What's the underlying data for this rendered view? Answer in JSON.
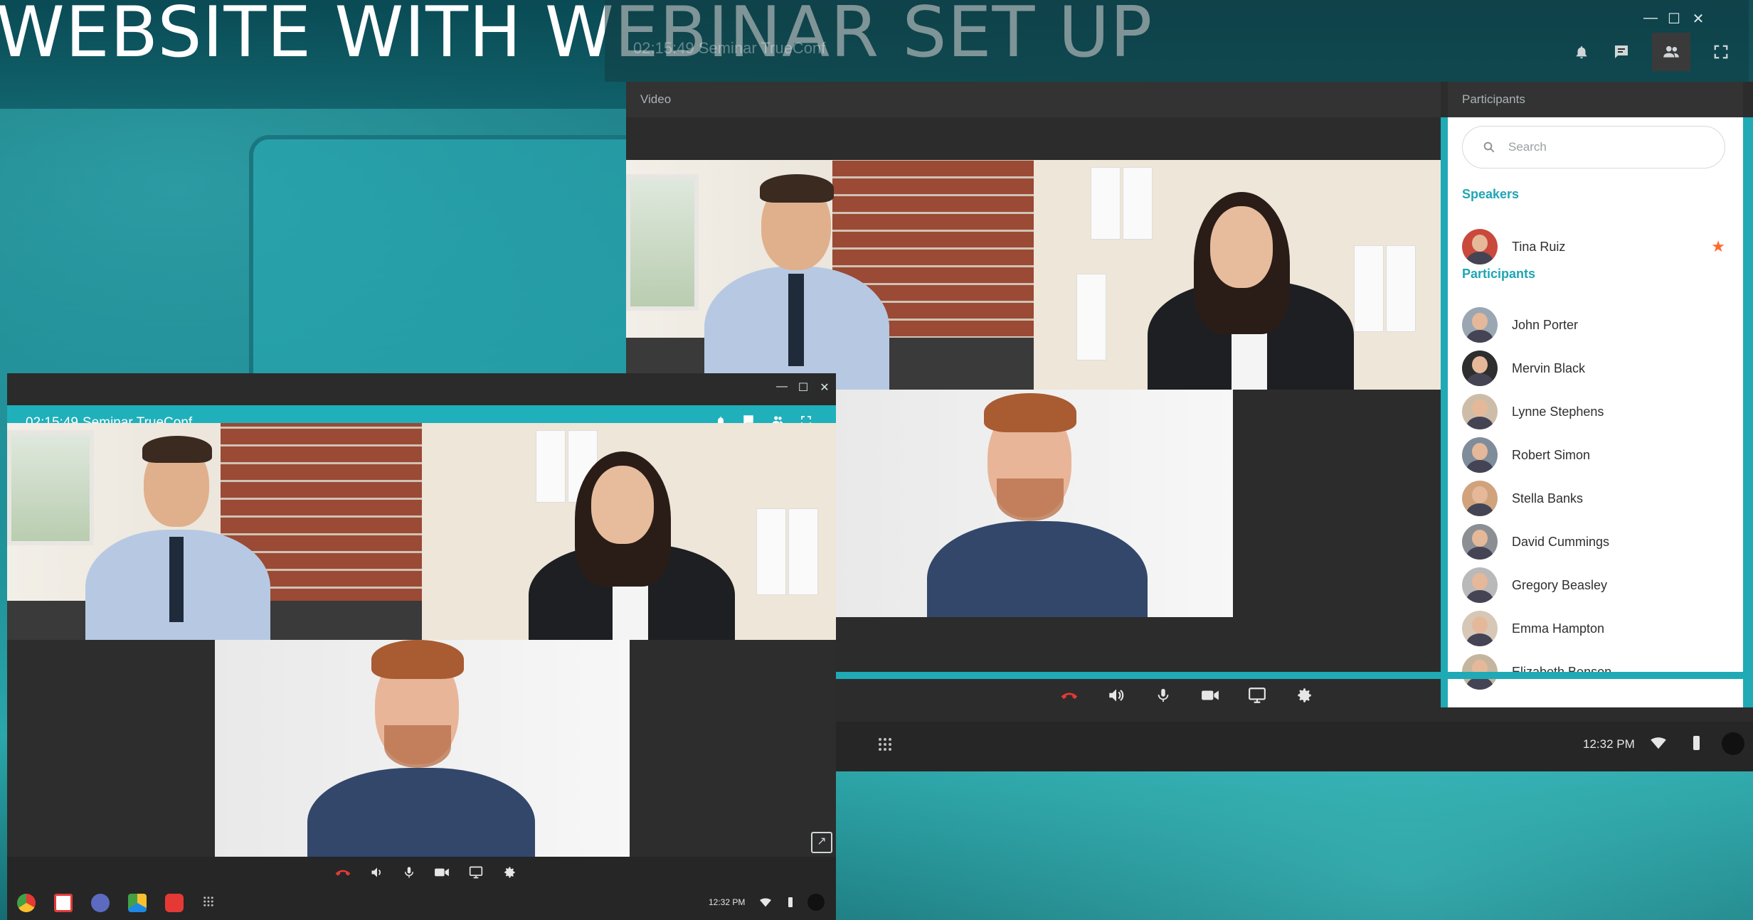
{
  "headline": "WEBSITE WITH WEBINAR SET UP",
  "bg_window": {
    "title_partial": "02:15:49  Seminar TrueConf"
  },
  "big_window": {
    "video_header": "Video",
    "participants_header": "Participants",
    "top_icons": [
      "bell-icon",
      "chat-icon",
      "people-icon",
      "fullscreen-icon"
    ],
    "search_placeholder": "Search",
    "speakers_title": "Speakers",
    "speakers": [
      {
        "name": "Tina Ruiz",
        "starred": true
      }
    ],
    "participants_title": "Participants",
    "participants": [
      "John Porter",
      "Mervin Black",
      "Lynne Stephens",
      "Robert Simon",
      "Stella Banks",
      "David Cummings",
      "Gregory Beasley",
      "Emma Hampton",
      "Elizabeth Benson"
    ],
    "controls": [
      "hangup-icon",
      "speaker-icon",
      "mic-icon",
      "camera-icon",
      "screen-share-icon",
      "settings-icon"
    ],
    "clock": "12:32 PM"
  },
  "small_window": {
    "timer": "02:15:49",
    "title": "Seminar TrueConf",
    "controls": [
      "hangup-icon",
      "speaker-icon",
      "mic-icon",
      "camera-icon",
      "screen-share-icon",
      "settings-icon"
    ],
    "clock": "12:32 PM",
    "dock_apps": [
      "chrome-icon",
      "gmail-icon",
      "app-icon",
      "drive-icon",
      "youtube-icon",
      "apps-grid-icon"
    ]
  },
  "colors": {
    "accent": "#1fb0bb",
    "section_title": "#1fa5b4",
    "hangup": "#e53935",
    "star": "#ff6a2b"
  }
}
